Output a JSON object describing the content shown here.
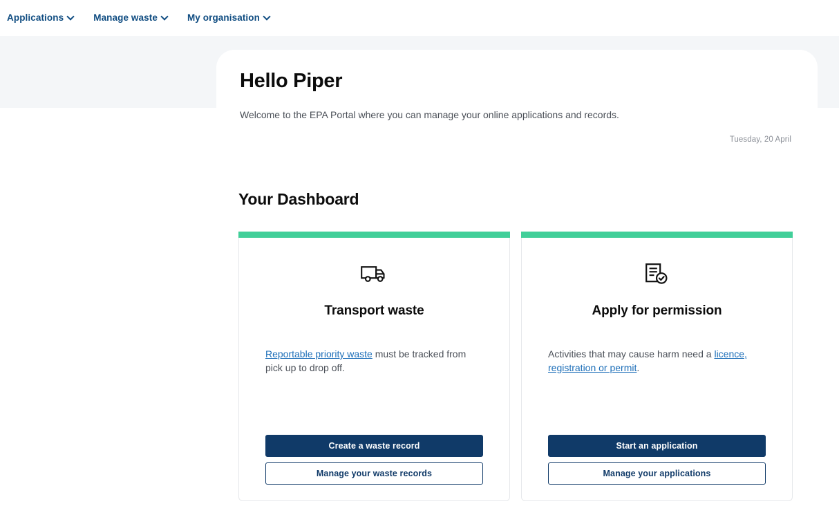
{
  "nav": {
    "items": [
      {
        "label": "Applications",
        "icon": "chevron-down-icon"
      },
      {
        "label": "Manage waste",
        "icon": "chevron-down-icon"
      },
      {
        "label": "My organisation",
        "icon": "chevron-down-icon"
      }
    ]
  },
  "hero": {
    "title": "Hello Piper",
    "date": "Tuesday, 20 April",
    "subtitle": "Welcome to the EPA Portal where you can manage your online applications and records."
  },
  "dashboard": {
    "heading": "Your Dashboard",
    "cards": [
      {
        "icon": "truck-icon",
        "title": "Transport waste",
        "body_link": "Reportable priority waste",
        "body_text_after": " must be tracked from pick up to drop off.",
        "primary_label": "Create a waste record",
        "secondary_label": "Manage your waste records"
      },
      {
        "icon": "document-check-icon",
        "title": "Apply for permission",
        "body_text_before": "Activities that may cause harm need a ",
        "body_link": "licence, registration or permit",
        "body_text_after": ".",
        "primary_label": "Start an application",
        "secondary_label": "Manage your applications"
      }
    ]
  },
  "colors": {
    "accent_green": "#41cf99",
    "navy": "#103a68",
    "nav_blue": "#0f4c81",
    "link_blue": "#1c6eb8",
    "band_grey": "#f4f6f8"
  }
}
